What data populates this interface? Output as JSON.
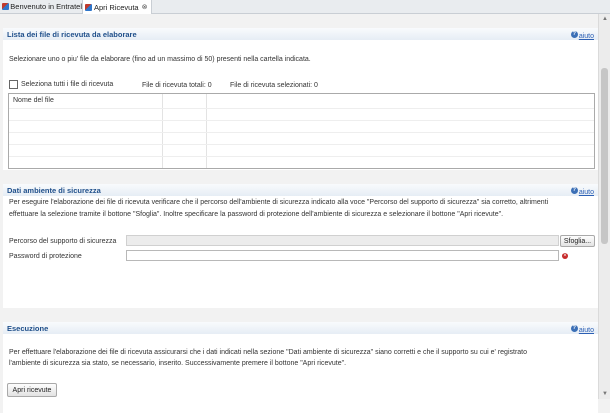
{
  "tabs": [
    {
      "label": "Benvenuto in Entratel",
      "active": false
    },
    {
      "label": "Apri Ricevuta",
      "active": true,
      "close": "⊗"
    }
  ],
  "help_label": "aiuto",
  "help_icon": "?",
  "section_files": {
    "title": "Lista dei file di ricevuta da elaborare",
    "description": "Selezionare uno o piu' file da elaborare (fino ad un massimo di 50) presenti nella cartella indicata.",
    "select_all_label": "Seleziona tutti i file di ricevuta",
    "select_all_checked": false,
    "total_label": "File di ricevuta totali: 0",
    "selected_label": "File di ricevuta selezionati: 0",
    "table_header": "Nome del file",
    "rows": []
  },
  "section_security": {
    "title": "Dati ambiente di sicurezza",
    "description_line1": "Per eseguire l'elaborazione dei file di ricevuta verificare che il percorso dell'ambiente di sicurezza indicato alla voce \"Percorso del supporto di sicurezza\" sia corretto, altrimenti",
    "description_line2": "effettuare la selezione tramite il bottone \"Sfoglia\". Inoltre specificare la password di protezione dell'ambiente di sicurezza e selezionare il bottone \"Apri ricevute\".",
    "path_label": "Percorso del supporto di sicurezza",
    "path_value": "",
    "browse_button": "Sfoglia...",
    "password_label": "Password di protezione",
    "password_value": ""
  },
  "section_execution": {
    "title": "Esecuzione",
    "description_line1": "Per effettuare l'elaborazione dei file di ricevuta assicurarsi che i dati indicati nella sezione \"Dati ambiente di sicurezza\" siano corretti e che il supporto su cui e' registrato",
    "description_line2": "l'ambiente di sicurezza sia stato, se necessario, inserito. Successivamente premere il bottone \"Apri ricevute\".",
    "open_button": "Apri ricevute"
  },
  "colors": {
    "section_title": "#1f4f8a",
    "link": "#2b5fb4",
    "error": "#c62828"
  }
}
